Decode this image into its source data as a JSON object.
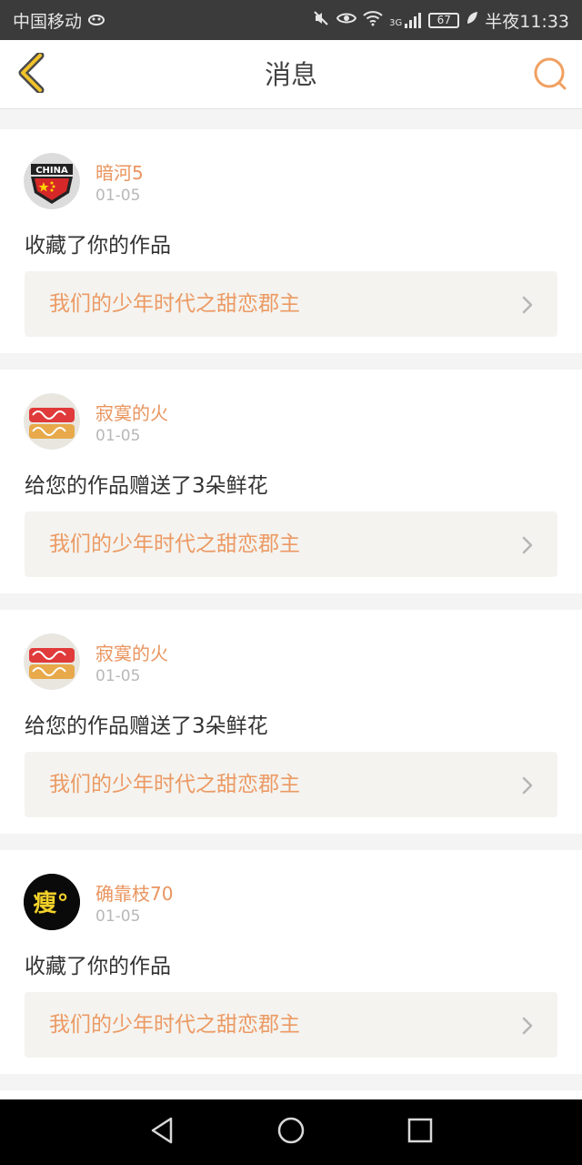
{
  "status_bar": {
    "carrier": "中国移动",
    "network": "3G",
    "battery": "67",
    "time": "半夜11:33"
  },
  "header": {
    "title": "消息",
    "back_icon": "chevron-left-icon",
    "search_icon": "search-icon"
  },
  "colors": {
    "accent": "#ec9a64",
    "username": "#e9955f",
    "card_link_bg": "#f4f3ef",
    "page_bg": "#f4f4f4"
  },
  "messages": [
    {
      "username": "暗河5",
      "date": "01-05",
      "action": "收藏了你的作品",
      "work_title": "我们的少年时代之甜恋郡主",
      "avatar": "china-flag-avatar",
      "avatar_text": "CHINA"
    },
    {
      "username": "寂寞的火",
      "date": "01-05",
      "action": "给您的作品赠送了3朵鲜花",
      "work_title": "我们的少年时代之甜恋郡主",
      "avatar": "decorative-avatar"
    },
    {
      "username": "寂寞的火",
      "date": "01-05",
      "action": "给您的作品赠送了3朵鲜花",
      "work_title": "我们的少年时代之甜恋郡主",
      "avatar": "decorative-avatar"
    },
    {
      "username": "确靠枝70",
      "date": "01-05",
      "action": "收藏了你的作品",
      "work_title": "我们的少年时代之甜恋郡主",
      "avatar": "text-avatar",
      "avatar_text": "瘦°"
    }
  ],
  "nav_bar": {
    "back": "nav-back-icon",
    "home": "nav-home-icon",
    "recents": "nav-recents-icon"
  }
}
